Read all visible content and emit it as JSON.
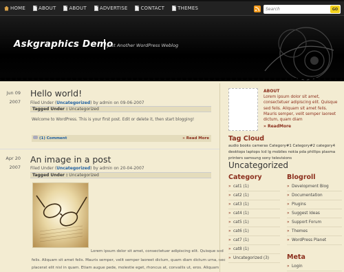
{
  "topbar": {
    "nav": [
      {
        "label": "HOME",
        "icon": "home-icon"
      },
      {
        "label": "ABOUT",
        "icon": "page-icon"
      },
      {
        "label": "ABOUT",
        "icon": "page-icon"
      },
      {
        "label": "ADVERTISE",
        "icon": "page-icon"
      },
      {
        "label": "CONTACT",
        "icon": "page-icon"
      },
      {
        "label": "THEMES",
        "icon": "page-icon"
      }
    ],
    "search_placeholder": "Search",
    "search_button": "GO"
  },
  "header": {
    "title": "Askgraphics Demo",
    "tagline": "Just Another WordPress Weblog"
  },
  "posts": [
    {
      "date_day": "Jun 09",
      "date_year": "2007",
      "title": "Hello world!",
      "filed_prefix": "Filed Under (",
      "category": "Uncategorized",
      "filed_suffix": ") by admin on 09-06-2007",
      "tagged_label": "Tagged Under :",
      "tagged_value": "Uncategorized",
      "content": "Welcome to WordPress. This is your first post. Edit or delete it, then start blogging!",
      "comments": "(1) Comment",
      "read_more": "Read More"
    },
    {
      "date_day": "Apr 20",
      "date_year": "2007",
      "title": "An image in a post",
      "filed_prefix": "Filed Under (",
      "category": "Uncategorized",
      "filed_suffix": ") by admin on 20-04-2007",
      "tagged_label": "Tagged Under :",
      "tagged_value": "Uncategorized",
      "line1": "Lorem ipsum dolor sit amet, consectetuer adipiscing elit. Quisque sed",
      "line2": "felis. Aliquam sit amet felis. Mauris semper, velit semper laoreet dictum, quam diam dictum urna, nec",
      "line3": "placerat elit nisl in quam. Etiam augue pede, molestie eget, rhoncus at, convallis ut, eros. Aliquam"
    }
  ],
  "about": {
    "title": "ABOUT",
    "text": "Lorem ipsum dolor sit amet, consectetuer adipiscing elit. Quisque sed felis. Aliquam sit amet felis. Mauris semper, velit semper laoreet dictum, quam diam",
    "more": "» ReadMore"
  },
  "tag_cloud": {
    "title": "Tag Cloud",
    "small": "audio books cameras Category#1 Category#2 category4 desktops laptops lcd lg mobiles nokia pda phillips plasma printers samsung sony televisions",
    "big": "Uncategorized"
  },
  "category": {
    "title": "Category",
    "items": [
      "cat1 (1)",
      "cat2 (1)",
      "cat3 (1)",
      "cat4 (1)",
      "cat5 (1)",
      "cat6 (1)",
      "cat7 (1)",
      "cat8 (1)",
      "Uncategorized (3)"
    ]
  },
  "blogroll": {
    "title": "Blogroll",
    "items": [
      "Development Blog",
      "Documentation",
      "Plugins",
      "Suggest Ideas",
      "Support Forum",
      "Themes",
      "WordPress Planet"
    ]
  },
  "meta": {
    "title": "Meta",
    "items": [
      "Login"
    ]
  }
}
